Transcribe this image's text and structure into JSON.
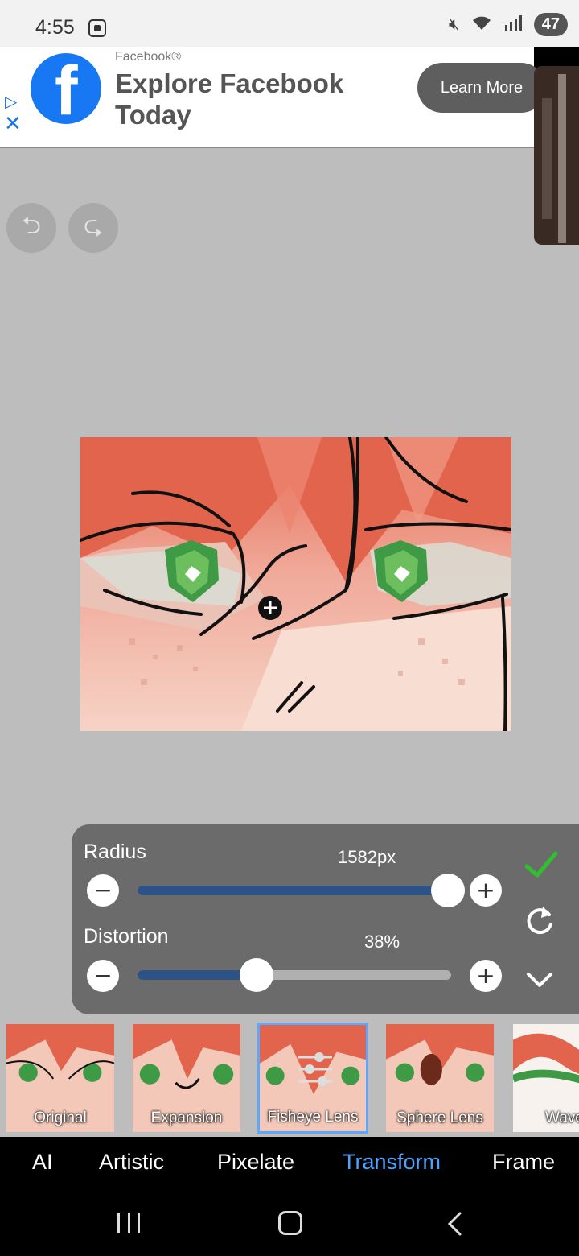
{
  "status_bar": {
    "time": "4:55",
    "battery": "47",
    "icons": [
      "screenshot-icon",
      "mute-icon",
      "wifi-icon",
      "signal-icon"
    ]
  },
  "ad": {
    "brand": "Facebook®",
    "title": "Explore Facebook Today",
    "cta": "Learn More",
    "colors": {
      "facebook_blue": "#1877f2",
      "adchoices_blue": "#1a73e8"
    }
  },
  "toolbar": {
    "undo_icon": "undo-icon",
    "redo_icon": "redo-icon"
  },
  "panel": {
    "radius": {
      "label": "Radius",
      "value": "1582px",
      "fraction": 0.99
    },
    "distortion": {
      "label": "Distortion",
      "value": "38%",
      "fraction": 0.38
    },
    "minus_glyph": "−",
    "plus_glyph": "+",
    "colors": {
      "panel_bg": "#6b6b6b",
      "fill": "#2c5286",
      "confirm": "#2ec02e"
    }
  },
  "effects": [
    {
      "label": "Original"
    },
    {
      "label": "Expansion"
    },
    {
      "label": "Fisheye Lens",
      "selected": true
    },
    {
      "label": "Sphere Lens"
    },
    {
      "label": "Wave"
    }
  ],
  "categories": [
    {
      "label": "AI"
    },
    {
      "label": "Artistic"
    },
    {
      "label": "Pixelate"
    },
    {
      "label": "Transform",
      "active": true
    },
    {
      "label": "Frame"
    }
  ],
  "accent_color": "#4da3ff"
}
